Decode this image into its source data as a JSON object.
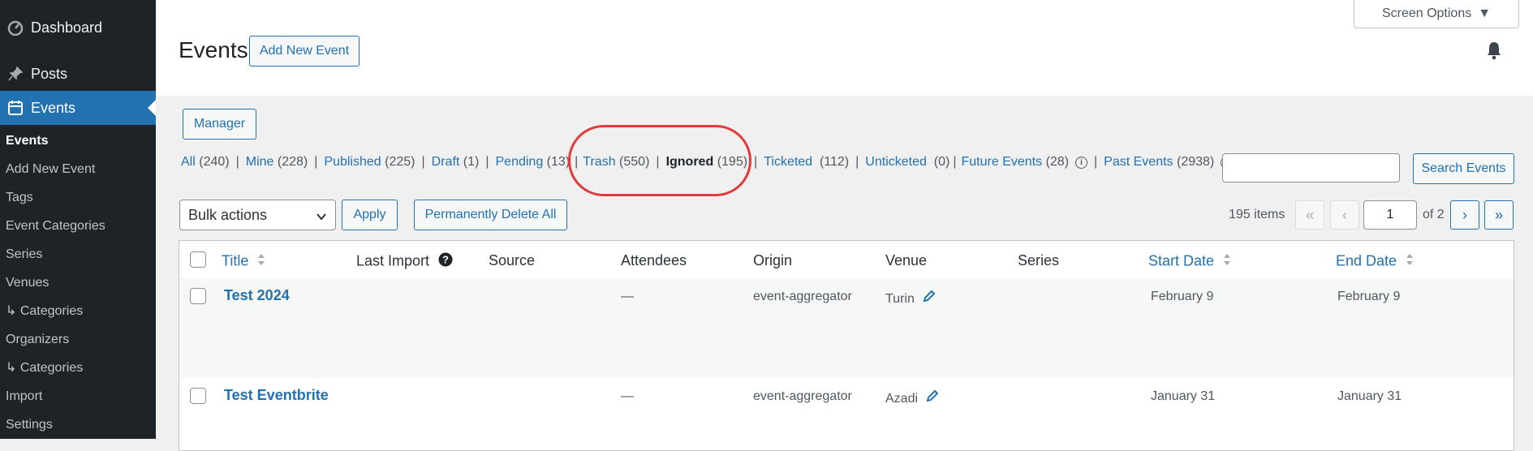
{
  "sidebar": {
    "dashboard": "Dashboard",
    "posts": "Posts",
    "events": "Events",
    "submenu": [
      "Events",
      "Add New Event",
      "Tags",
      "Event Categories",
      "Series",
      "Venues",
      "↳ Categories",
      "Organizers",
      "↳ Categories",
      "Import",
      "Settings"
    ]
  },
  "header": {
    "title": "Events",
    "add_new": "Add New Event",
    "screen_options": "Screen Options",
    "manager": "Manager"
  },
  "filters": [
    {
      "label": "All",
      "count": "(240)"
    },
    {
      "label": "Mine",
      "count": "(228)"
    },
    {
      "label": "Published",
      "count": "(225)"
    },
    {
      "label": "Draft",
      "count": "(1)"
    },
    {
      "label": "Pending",
      "count": "(13)"
    },
    {
      "label": "Trash",
      "count": "(550)"
    },
    {
      "label": "Ignored",
      "count": "(195)"
    },
    {
      "label": "Ticketed",
      "count": "(112)"
    },
    {
      "label": "Unticketed",
      "count": "(0)"
    },
    {
      "label": "Future Events",
      "count": "(28)"
    },
    {
      "label": "Past Events",
      "count": "(2938)"
    }
  ],
  "search": {
    "button": "Search Events",
    "value": ""
  },
  "bulk": {
    "selected": "Bulk actions",
    "apply": "Apply",
    "delete_all": "Permanently Delete All"
  },
  "pagination": {
    "items": "195 items",
    "first": "«",
    "prev": "‹",
    "next": "›",
    "last": "»",
    "current": "1",
    "of": "of 2"
  },
  "table": {
    "columns": {
      "title": "Title",
      "last_import": "Last Import",
      "source": "Source",
      "attendees": "Attendees",
      "origin": "Origin",
      "venue": "Venue",
      "series": "Series",
      "start": "Start Date",
      "end": "End Date"
    },
    "rows": [
      {
        "title": "Test 2024",
        "attendees": "—",
        "origin": "event-aggregator",
        "venue": "Turin",
        "start": "February 9",
        "end": "February 9"
      },
      {
        "title": "Test Eventbrite",
        "attendees": "—",
        "origin": "event-aggregator",
        "venue": "Azadi",
        "start": "January 31",
        "end": "January 31"
      }
    ]
  },
  "colors": {
    "accent": "#2271b1",
    "sidebar": "#1d2327",
    "highlight": "#e23b3b"
  }
}
